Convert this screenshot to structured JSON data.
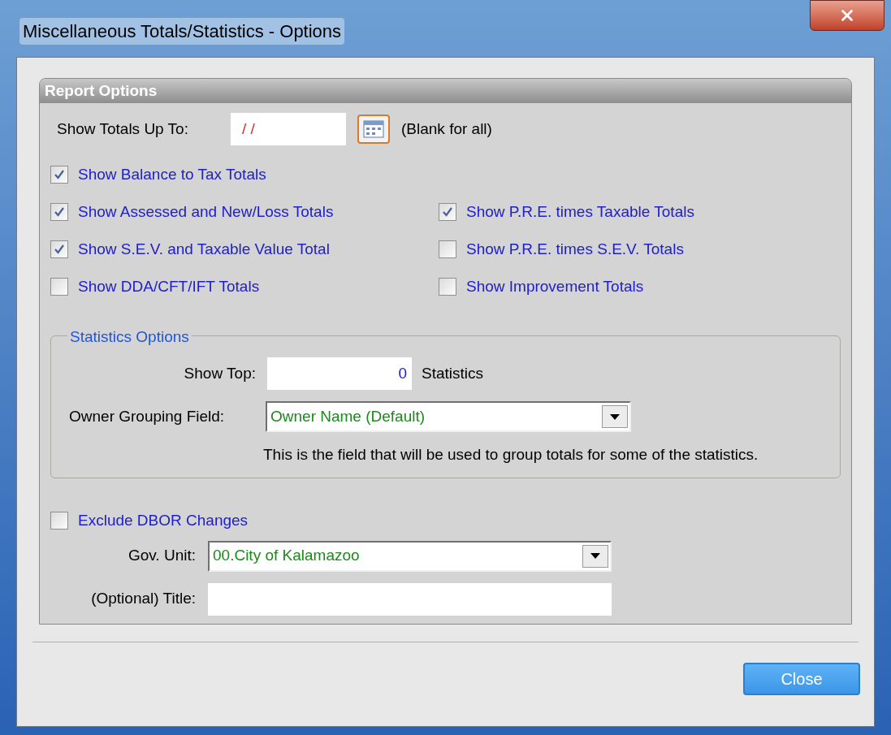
{
  "window": {
    "title": "Miscellaneous Totals/Statistics -  Options"
  },
  "report_options": {
    "title": "Report Options",
    "show_totals": {
      "label": "Show Totals Up To:",
      "value": "/ /",
      "hint": "(Blank for all)"
    },
    "checkbox_rows": [
      {
        "items": [
          {
            "label": "Show Balance to Tax Totals",
            "checked": true
          }
        ]
      },
      {
        "items": [
          {
            "label": "Show Assessed and New/Loss Totals",
            "checked": true
          },
          {
            "label": "Show P.R.E. times Taxable Totals",
            "checked": true
          }
        ]
      },
      {
        "items": [
          {
            "label": "Show S.E.V. and Taxable Value Total",
            "checked": true
          },
          {
            "label": "Show P.R.E. times S.E.V. Totals",
            "checked": false
          }
        ]
      },
      {
        "items": [
          {
            "label": "Show DDA/CFT/IFT Totals",
            "checked": false
          },
          {
            "label": "Show Improvement Totals",
            "checked": false
          }
        ]
      }
    ],
    "statistics": {
      "title": "Statistics Options",
      "show_top_label": "Show Top:",
      "show_top_value": "0",
      "show_top_suffix": "Statistics",
      "grouping_label": "Owner Grouping Field:",
      "grouping_value": "Owner Name (Default)",
      "note": "This is the field that will be used to group totals for some of the statistics."
    },
    "exclude": {
      "label": "Exclude DBOR Changes",
      "checked": false
    },
    "gov_unit": {
      "label": "Gov. Unit:",
      "value": "00.City of Kalamazoo"
    },
    "title_field": {
      "label": "(Optional) Title:"
    }
  },
  "buttons": [
    {
      "label": "Close"
    }
  ]
}
